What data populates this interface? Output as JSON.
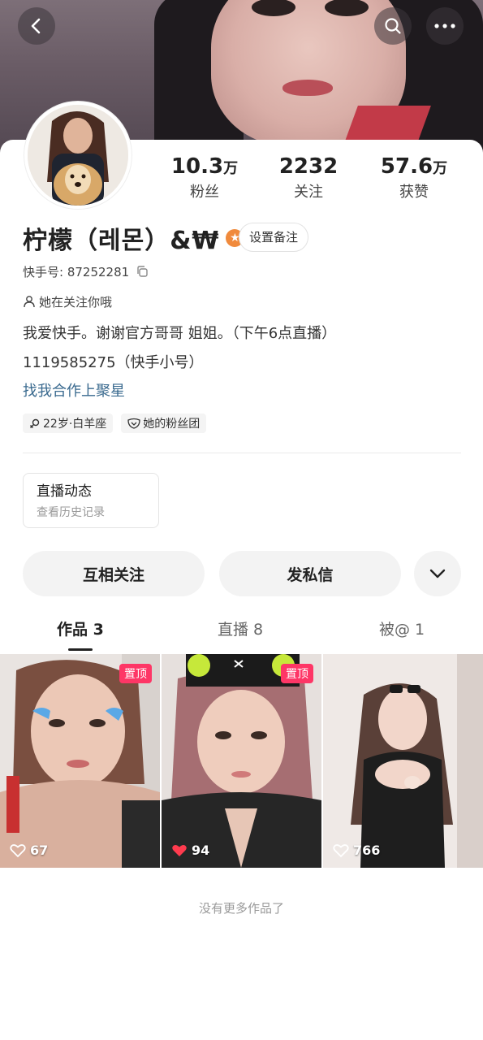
{
  "header": {
    "back_icon": "chevron-left-icon",
    "search_icon": "search-icon",
    "more_icon": "more-dots-icon"
  },
  "profile": {
    "name": "柠檬（레몬）&₩",
    "remark_button": "设置备注",
    "kuaishou_id": "快手号: 87252281",
    "follow_status": "她在关注你哦",
    "bio_line1": "我爱快手。谢谢官方哥哥 姐姐。（下午6点直播）",
    "bio_line2": "1119585275（快手小号）",
    "cooperation_link": "找我合作上聚星",
    "tags": [
      {
        "label": "22岁·白羊座",
        "icon": "female-icon"
      },
      {
        "label": "她的粉丝团",
        "icon": "fan-club-icon"
      }
    ]
  },
  "stats": [
    {
      "value": "10.3",
      "unit": "万",
      "label": "粉丝"
    },
    {
      "value": "2232",
      "unit": "",
      "label": "关注"
    },
    {
      "value": "57.6",
      "unit": "万",
      "label": "获赞"
    }
  ],
  "live_card": {
    "title": "直播动态",
    "subtitle": "查看历史记录"
  },
  "actions": {
    "mutual_follow": "互相关注",
    "send_message": "发私信"
  },
  "tabs": [
    {
      "label": "作品 3",
      "active": true
    },
    {
      "label": "直播 8",
      "active": false
    },
    {
      "label": "被@ 1",
      "active": false
    }
  ],
  "posts": [
    {
      "likes": "67",
      "pinned": true,
      "pin_label": "置顶",
      "liked": false
    },
    {
      "likes": "94",
      "pinned": true,
      "pin_label": "置顶",
      "liked": true
    },
    {
      "likes": "766",
      "pinned": false,
      "pin_label": "",
      "liked": false
    }
  ],
  "footer": {
    "no_more": "没有更多作品了"
  },
  "colors": {
    "pin": "#fe3666",
    "link": "#3a6a8f",
    "star_badge": "#f08a3c",
    "like_red": "#ff3b4e"
  }
}
